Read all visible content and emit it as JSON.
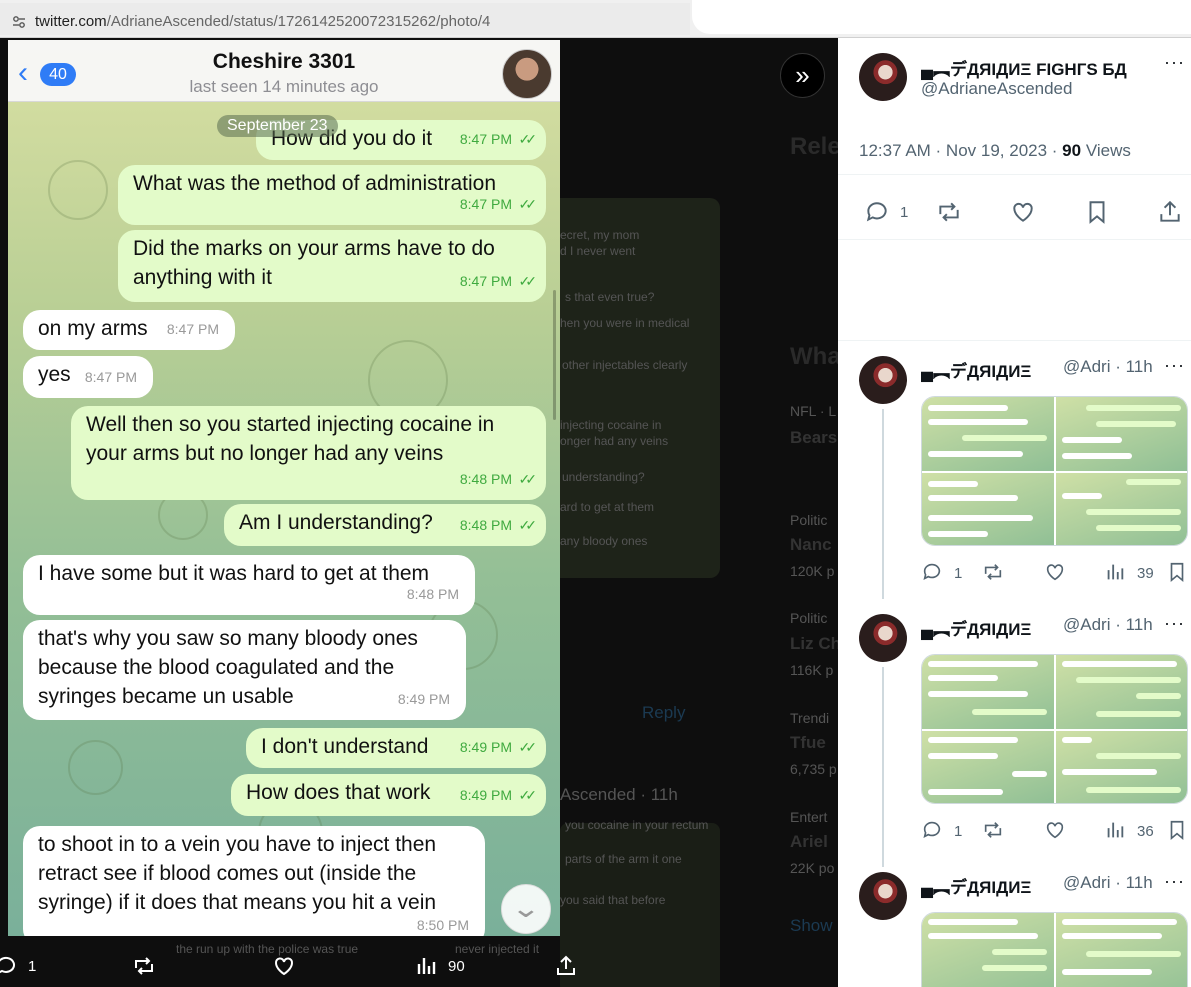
{
  "browser": {
    "url_host": "twitter.com",
    "url_path": "/AdrianeAscended/status/1726142520072315262/photo/4"
  },
  "telegram": {
    "back_count": "40",
    "contact_name": "Cheshire 3301",
    "status": "last seen 14 minutes ago",
    "date_label": "September 23",
    "messages": [
      {
        "dir": "out",
        "lines": [
          "How did you do it"
        ],
        "time": "8:47 PM"
      },
      {
        "dir": "out",
        "lines": [
          "What was the method of administration"
        ],
        "time": "8:47 PM"
      },
      {
        "dir": "out",
        "lines": [
          "Did the marks on your arms have to do",
          "anything with it"
        ],
        "time": "8:47 PM"
      },
      {
        "dir": "in",
        "lines": [
          "on my arms"
        ],
        "time": "8:47 PM"
      },
      {
        "dir": "in",
        "lines": [
          "yes"
        ],
        "time": "8:47 PM"
      },
      {
        "dir": "out",
        "lines": [
          "Well then so you started injecting cocaine in",
          "your arms but no longer had any veins"
        ],
        "time": "8:48 PM"
      },
      {
        "dir": "out",
        "lines": [
          "Am I understanding?"
        ],
        "time": "8:48 PM"
      },
      {
        "dir": "in",
        "lines": [
          "I have some but it was hard to get at them"
        ],
        "time": "8:48 PM"
      },
      {
        "dir": "in",
        "lines": [
          "that's why you saw so many bloody ones",
          "because the blood coagulated and the",
          "syringes became un usable"
        ],
        "time": "8:49 PM"
      },
      {
        "dir": "out",
        "lines": [
          "I don't understand"
        ],
        "time": "8:49 PM"
      },
      {
        "dir": "out",
        "lines": [
          "How does that work"
        ],
        "time": "8:49 PM"
      },
      {
        "dir": "in",
        "lines": [
          "to shoot in to a vein you have to inject then",
          "retract see if blood comes out (inside the",
          "syringe) if it does that means you hit a vein"
        ],
        "time": "8:50 PM"
      }
    ]
  },
  "viewer_actions": {
    "replies": "1",
    "views": "90"
  },
  "background_text": {
    "related": "Rele",
    "whats": "Wha",
    "nfl": "NFL · L",
    "bears": "Bears",
    "politics1": "Politic",
    "nanc": "Nanc",
    "posts1": "120K p",
    "politics2": "Politic",
    "liz": "Liz Ch",
    "posts2": "116K p",
    "trending": "Trendi",
    "tfue": "Tfue",
    "posts3": "6,735 p",
    "entertainment": "Entert",
    "ariel": "Ariel",
    "posts4": "22K po",
    "show": "Show",
    "reply": "Reply",
    "author_ghost": "Ascended · 11h",
    "g1": "ecret, my mom",
    "g2": "d I never went",
    "g3": "s that even true?",
    "g4": "hen you were in medical",
    "g5": "other injectables clearly",
    "g6": "injecting cocaine in",
    "g7": "onger had any veins",
    "g8": "understanding?",
    "g9": "ard to get at them",
    "g10": "any bloody ones",
    "g11": "you cocaine in your rectum",
    "g12": "parts of the arm it one",
    "g13": "you said that before",
    "g14": "the run up with the police was true",
    "g15": "never injected it"
  },
  "panel": {
    "main": {
      "name": "▄︻デДЯIДИΞ FIGHГS БД",
      "handle": "@AdrianeAscended",
      "time": "12:37 AM · Nov 19, 2023 · ",
      "views_num": "90",
      "views_label": " Views",
      "replies": "1"
    },
    "replies": [
      {
        "name": "▄︻デДЯIДИΞ",
        "handle": "@Adri · 11h",
        "replies": "1",
        "views": "39"
      },
      {
        "name": "▄︻デДЯIДИΞ",
        "handle": "@Adri · 11h",
        "replies": "1",
        "views": "36"
      },
      {
        "name": "▄︻デДЯIДИΞ",
        "handle": "@Adri · 11h"
      }
    ]
  }
}
